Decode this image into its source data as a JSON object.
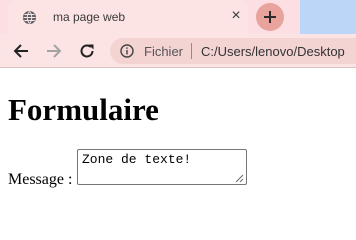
{
  "browser": {
    "tab": {
      "title": "ma page web",
      "favicon": "globe-icon",
      "close": "×"
    },
    "new_tab_icon": "plus-icon",
    "toolbar": {
      "back_icon": "back-arrow-icon",
      "forward_icon": "forward-arrow-icon",
      "reload_icon": "reload-icon",
      "info_icon": "info-icon",
      "scheme_label": "Fichier",
      "url": "C:/Users/lenovo/Desktop"
    },
    "colors": {
      "tab_strip": "#fcdfe2",
      "new_tab_button": "#e8a39c",
      "omnibox": "#f4d3d3"
    }
  },
  "page": {
    "heading": "Formulaire",
    "form": {
      "message_label": "Message :",
      "message_value": "Zone de texte!"
    }
  }
}
